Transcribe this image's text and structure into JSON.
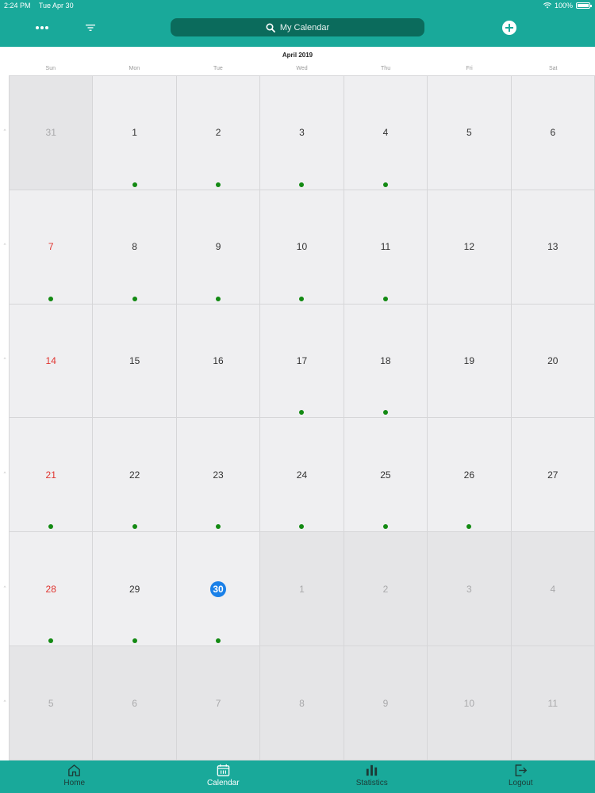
{
  "statusbar": {
    "time": "2:24 PM",
    "date": "Tue Apr 30",
    "battery": "100%"
  },
  "navbar": {
    "search_label": "My Calendar",
    "icons": [
      "more-icon",
      "filter-icon",
      "search-icon",
      "add-icon"
    ]
  },
  "calendar": {
    "month_title": "April 2019",
    "weekdays": [
      "Sun",
      "Mon",
      "Tue",
      "Wed",
      "Thu",
      "Fri",
      "Sat"
    ],
    "week_markers": [
      "^",
      "^",
      "^",
      "^",
      "^",
      "^"
    ],
    "weeks": [
      [
        {
          "day": "31",
          "in_month": false,
          "dot": false
        },
        {
          "day": "1",
          "in_month": true,
          "dot": true
        },
        {
          "day": "2",
          "in_month": true,
          "dot": true
        },
        {
          "day": "3",
          "in_month": true,
          "dot": true
        },
        {
          "day": "4",
          "in_month": true,
          "dot": true
        },
        {
          "day": "5",
          "in_month": true,
          "dot": false
        },
        {
          "day": "6",
          "in_month": true,
          "dot": false
        }
      ],
      [
        {
          "day": "7",
          "in_month": true,
          "dot": true
        },
        {
          "day": "8",
          "in_month": true,
          "dot": true
        },
        {
          "day": "9",
          "in_month": true,
          "dot": true
        },
        {
          "day": "10",
          "in_month": true,
          "dot": true
        },
        {
          "day": "11",
          "in_month": true,
          "dot": true
        },
        {
          "day": "12",
          "in_month": true,
          "dot": false
        },
        {
          "day": "13",
          "in_month": true,
          "dot": false
        }
      ],
      [
        {
          "day": "14",
          "in_month": true,
          "dot": false
        },
        {
          "day": "15",
          "in_month": true,
          "dot": false
        },
        {
          "day": "16",
          "in_month": true,
          "dot": false
        },
        {
          "day": "17",
          "in_month": true,
          "dot": true
        },
        {
          "day": "18",
          "in_month": true,
          "dot": true
        },
        {
          "day": "19",
          "in_month": true,
          "dot": false
        },
        {
          "day": "20",
          "in_month": true,
          "dot": false
        }
      ],
      [
        {
          "day": "21",
          "in_month": true,
          "dot": true
        },
        {
          "day": "22",
          "in_month": true,
          "dot": true
        },
        {
          "day": "23",
          "in_month": true,
          "dot": true
        },
        {
          "day": "24",
          "in_month": true,
          "dot": true
        },
        {
          "day": "25",
          "in_month": true,
          "dot": true
        },
        {
          "day": "26",
          "in_month": true,
          "dot": true
        },
        {
          "day": "27",
          "in_month": true,
          "dot": false
        }
      ],
      [
        {
          "day": "28",
          "in_month": true,
          "dot": true
        },
        {
          "day": "29",
          "in_month": true,
          "dot": true
        },
        {
          "day": "30",
          "in_month": true,
          "dot": true,
          "today": true
        },
        {
          "day": "1",
          "in_month": false,
          "dot": false
        },
        {
          "day": "2",
          "in_month": false,
          "dot": false
        },
        {
          "day": "3",
          "in_month": false,
          "dot": false
        },
        {
          "day": "4",
          "in_month": false,
          "dot": false
        }
      ],
      [
        {
          "day": "5",
          "in_month": false,
          "dot": false
        },
        {
          "day": "6",
          "in_month": false,
          "dot": false
        },
        {
          "day": "7",
          "in_month": false,
          "dot": false
        },
        {
          "day": "8",
          "in_month": false,
          "dot": false
        },
        {
          "day": "9",
          "in_month": false,
          "dot": false
        },
        {
          "day": "10",
          "in_month": false,
          "dot": false
        },
        {
          "day": "11",
          "in_month": false,
          "dot": false
        }
      ]
    ]
  },
  "tabbar": {
    "items": [
      {
        "label": "Home",
        "icon": "home-icon",
        "active": false
      },
      {
        "label": "Calendar",
        "icon": "calendar-icon",
        "active": true
      },
      {
        "label": "Statistics",
        "icon": "statistics-icon",
        "active": false
      },
      {
        "label": "Logout",
        "icon": "logout-icon",
        "active": false
      }
    ]
  },
  "colors": {
    "brand": "#19a99a",
    "search_bg": "#0b6b5c",
    "sunday": "#e0342f",
    "event_dot": "#138a13",
    "today": "#1a80e8"
  }
}
